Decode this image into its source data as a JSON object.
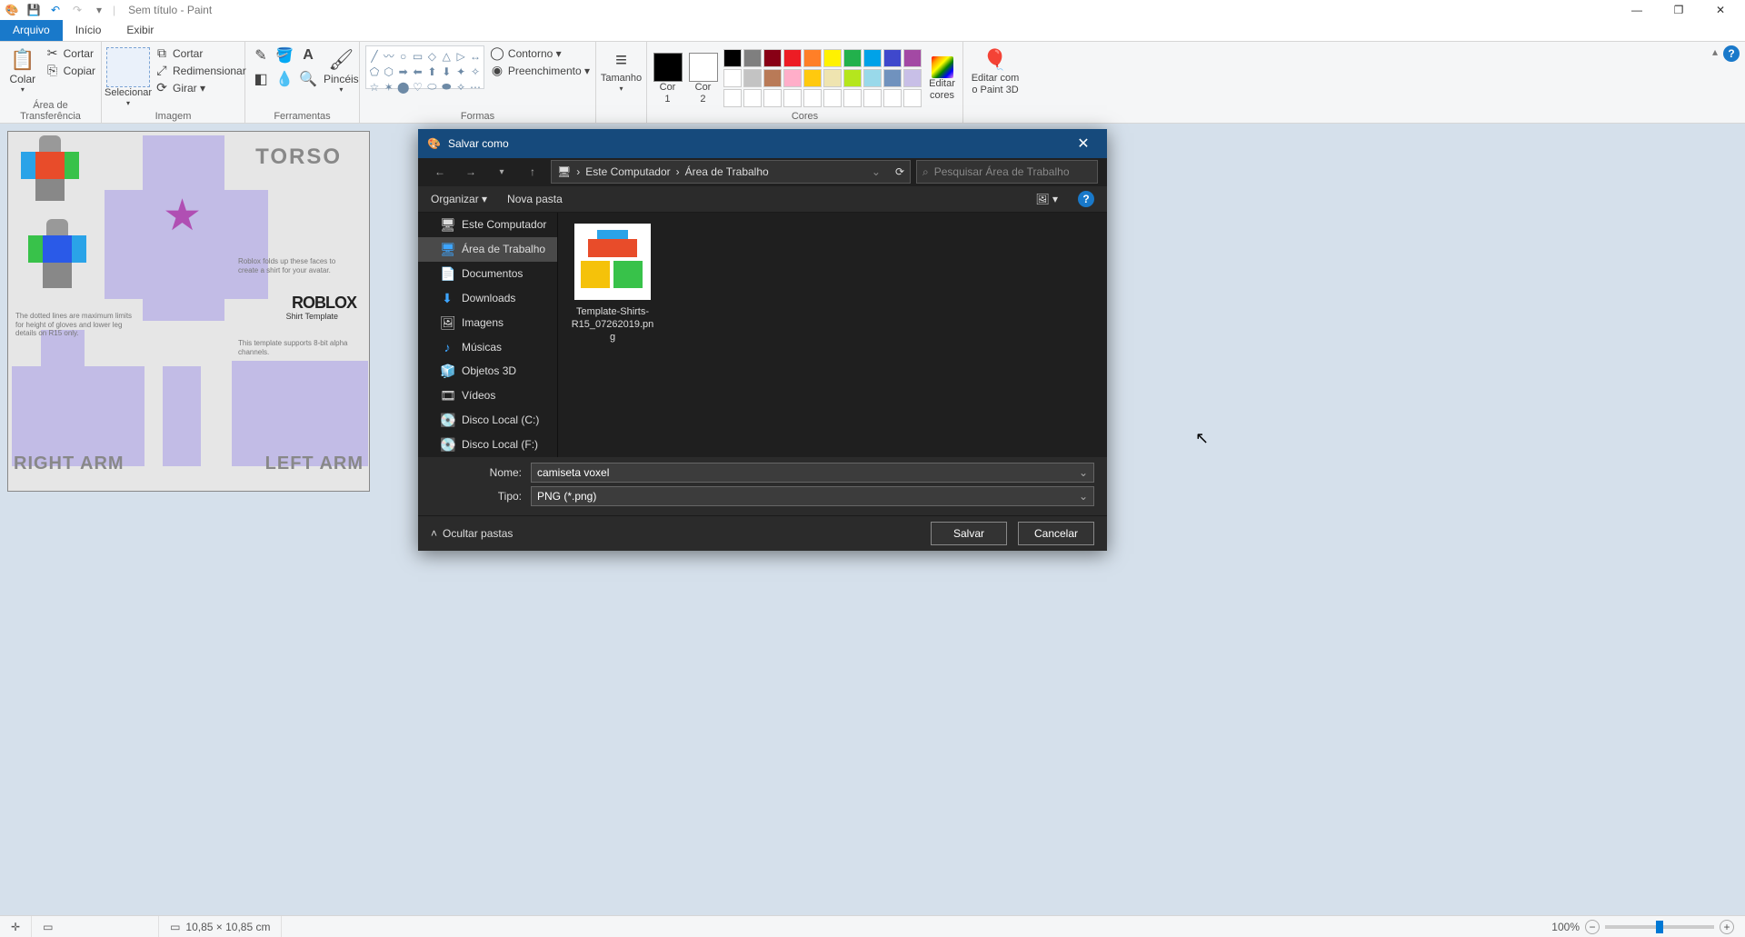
{
  "window": {
    "doc_title": "Sem título - Paint",
    "minimize": "—",
    "maximize": "❐",
    "close": "✕"
  },
  "tabs": {
    "file": "Arquivo",
    "home": "Início",
    "view": "Exibir"
  },
  "ribbon": {
    "clipboard": {
      "paste": "Colar",
      "cut": "Cortar",
      "copy": "Copiar",
      "group": "Área de Transferência"
    },
    "image": {
      "select": "Selecionar",
      "crop": "Cortar",
      "resize": "Redimensionar",
      "rotate": "Girar ▾",
      "group": "Imagem"
    },
    "tools": {
      "group": "Ferramentas",
      "brushes": "Pincéis"
    },
    "shapes": {
      "outline": "Contorno ▾",
      "fill": "Preenchimento ▾",
      "group": "Formas"
    },
    "size": {
      "label": "Tamanho"
    },
    "colors": {
      "c1": "Cor\n1",
      "c2": "Cor\n2",
      "edit": "Editar\ncores",
      "group": "Cores"
    },
    "p3d": {
      "label": "Editar com\no Paint 3D"
    }
  },
  "canvas": {
    "torso": "TORSO",
    "right_arm": "RIGHT ARM",
    "left_arm": "LEFT ARM",
    "roblox": "ROBLOX",
    "roblox_sub": "Shirt Template",
    "note1": "Roblox folds up these faces to create a shirt for your avatar.",
    "note2": "The dotted lines are maximum limits for height of gloves and lower leg details on R15 only.",
    "note3": "This template supports 8-bit alpha channels."
  },
  "dialog": {
    "title": "Salvar como",
    "breadcrumb": {
      "a": "Este Computador",
      "b": "Área de Trabalho"
    },
    "search_placeholder": "Pesquisar Área de Trabalho",
    "organize": "Organizar ▾",
    "new_folder": "Nova pasta",
    "tree": {
      "this_pc": "Este Computador",
      "desktop": "Área de Trabalho",
      "documents": "Documentos",
      "downloads": "Downloads",
      "images": "Imagens",
      "music": "Músicas",
      "objects3d": "Objetos 3D",
      "videos": "Vídeos",
      "disk_c": "Disco Local (C:)",
      "disk_f": "Disco Local (F:)"
    },
    "file": {
      "name": "Template-Shirts-R15_07262019.png"
    },
    "name_label": "Nome:",
    "name_value": "camiseta voxel",
    "type_label": "Tipo:",
    "type_value": "PNG (*.png)",
    "hide_folders": "Ocultar pastas",
    "save": "Salvar",
    "cancel": "Cancelar"
  },
  "statusbar": {
    "dim": "10,85 × 10,85 cm",
    "zoom": "100%"
  },
  "palette_row1": [
    "#000000",
    "#7f7f7f",
    "#880015",
    "#ed1c24",
    "#ff7f27",
    "#fff200",
    "#22b14c",
    "#00a2e8",
    "#3f48cc",
    "#a349a4"
  ],
  "palette_row2": [
    "#ffffff",
    "#c3c3c3",
    "#b97a57",
    "#ffaec9",
    "#ffc90e",
    "#efe4b0",
    "#b5e61d",
    "#99d9ea",
    "#7092be",
    "#c8bfe7"
  ],
  "palette_row3": [
    "#ffffff",
    "#ffffff",
    "#ffffff",
    "#ffffff",
    "#ffffff",
    "#ffffff",
    "#ffffff",
    "#ffffff",
    "#ffffff",
    "#ffffff"
  ]
}
